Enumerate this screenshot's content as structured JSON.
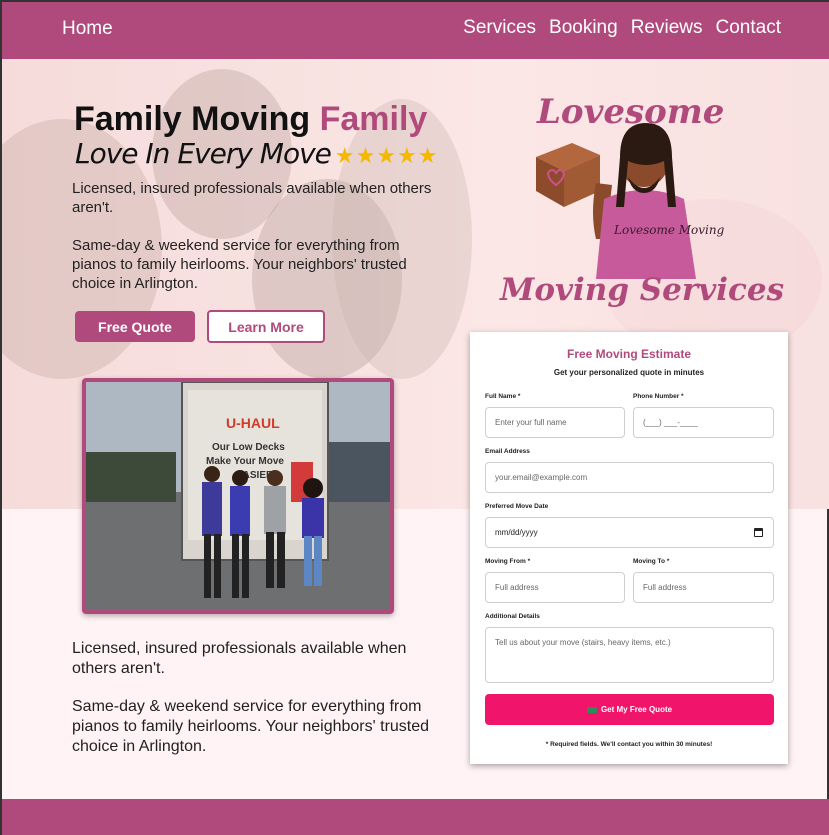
{
  "nav": {
    "home": "Home",
    "links": [
      "Services",
      "Booking",
      "Reviews",
      "Contact"
    ]
  },
  "hero": {
    "title_main": "Family Moving",
    "title_accent": "Family",
    "subtitle": "Love In Every Move",
    "stars": "★★★★★",
    "rating_stars": 5,
    "para1": "Licensed, insured professionals available when others aren't.",
    "para2": "Same-day & weekend service for everything from pianos to family heirlooms. Your neighbors' trusted choice in Arlington.",
    "quote_button": "Free Quote",
    "learn_button": "Learn More"
  },
  "truck_photo": {
    "brand": "U-HAUL",
    "slogan": "Our Low Decks Make Your Move EASIER!"
  },
  "lower_text": {
    "para1": "Licensed, insured professionals available when others aren't.",
    "para2": "Same-day & weekend service for everything from pianos to family heirlooms. Your neighbors' trusted choice in Arlington."
  },
  "logo": {
    "top": "Lovesome",
    "shirt": "Lovesome Moving",
    "bottom": "Moving Services"
  },
  "form": {
    "title": "Free Moving Estimate",
    "subtitle": "Get your personalized quote in minutes",
    "full_name_label": "Full Name *",
    "full_name_placeholder": "Enter your full name",
    "phone_label": "Phone Number *",
    "phone_placeholder": "(___) ___-____",
    "email_label": "Email Address",
    "email_placeholder": "your.email@example.com",
    "date_label": "Preferred Move Date",
    "date_placeholder": "mm/dd/yyyy",
    "from_label": "Moving From *",
    "from_placeholder": "Full address",
    "to_label": "Moving To *",
    "to_placeholder": "Full address",
    "details_label": "Additional Details",
    "details_placeholder": "Tell us about your move (stairs, heavy items, etc.)",
    "submit": "Get My Free Quote",
    "note": "* Required fields. We'll contact you within 30 minutes!"
  },
  "colors": {
    "brand": "#b14a7c",
    "submit": "#f0156a",
    "background": "#fff3f5"
  }
}
